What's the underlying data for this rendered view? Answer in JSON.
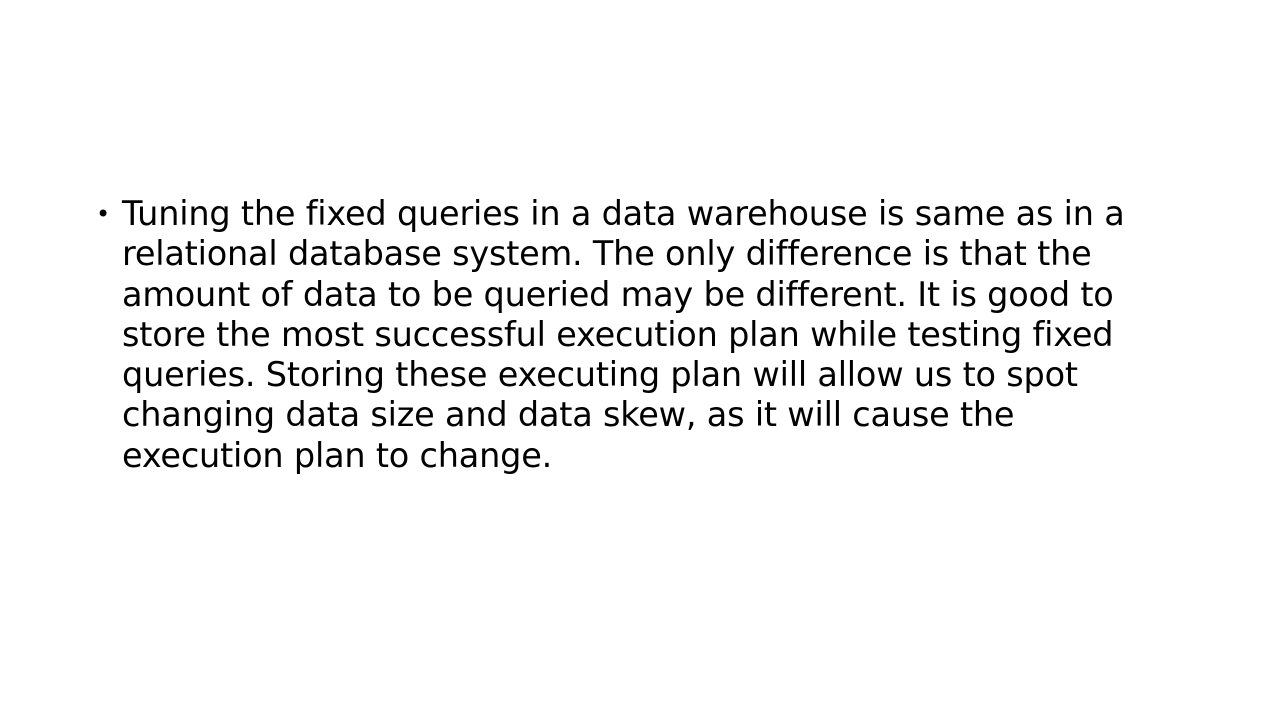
{
  "slide": {
    "bullets": [
      {
        "marker": "•",
        "text": "Tuning the fixed queries in a data warehouse is same as in a relational database system. The only difference is that the amount of data to be queried may be different. It is good to store the most successful execution plan while testing fixed queries. Storing these executing plan will allow us to spot changing data size and data skew, as it will cause the execution plan to change."
      }
    ]
  }
}
